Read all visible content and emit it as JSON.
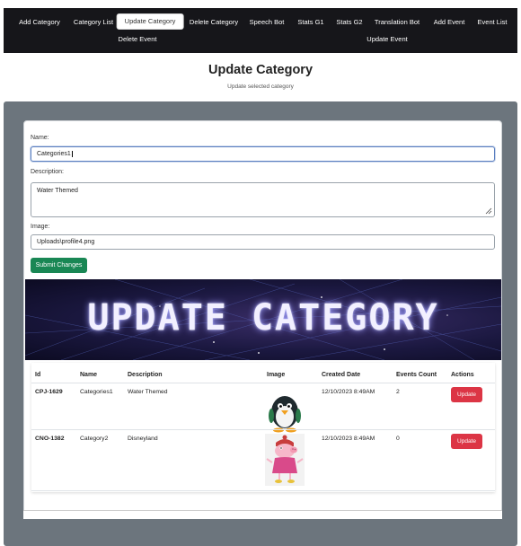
{
  "nav": {
    "items": [
      "Add Category",
      "Category List",
      "Update Category",
      "Delete Category",
      "Speech Bot",
      "Stats G1",
      "Stats G2",
      "Translation Bot",
      "Add Event",
      "Event List"
    ],
    "items_row2": [
      "Delete Event",
      "Update Event"
    ],
    "active": "Update Category"
  },
  "header": {
    "title": "Update Category",
    "subtitle": "Update selected category"
  },
  "form": {
    "name_label": "Name:",
    "name_value": "Categories1",
    "description_label": "Description:",
    "description_value": "Water Themed",
    "image_label": "Image:",
    "image_value": "Uploads\\profile4.png",
    "submit_label": "Submit Changes"
  },
  "banner": {
    "title": "UPDATE CATEGORY"
  },
  "table": {
    "headers": [
      "Id",
      "Name",
      "Description",
      "Image",
      "Created Date",
      "Events Count",
      "Actions"
    ],
    "rows": [
      {
        "id": "CPJ-1629",
        "name": "Categories1",
        "description": "Water Themed",
        "image_icon": "penguin-image-icon",
        "created": "12/10/2023 8:49AM",
        "events": "2",
        "action": "Update"
      },
      {
        "id": "CNO-1382",
        "name": "Category2",
        "description": "Disneyland",
        "image_icon": "peppa-pig-image-icon",
        "created": "12/10/2023 8:49AM",
        "events": "0",
        "action": "Update"
      }
    ]
  },
  "colors": {
    "nav_bg": "#16161a",
    "submit": "#198754",
    "update": "#dc3545",
    "page_bg": "#6c757d"
  }
}
